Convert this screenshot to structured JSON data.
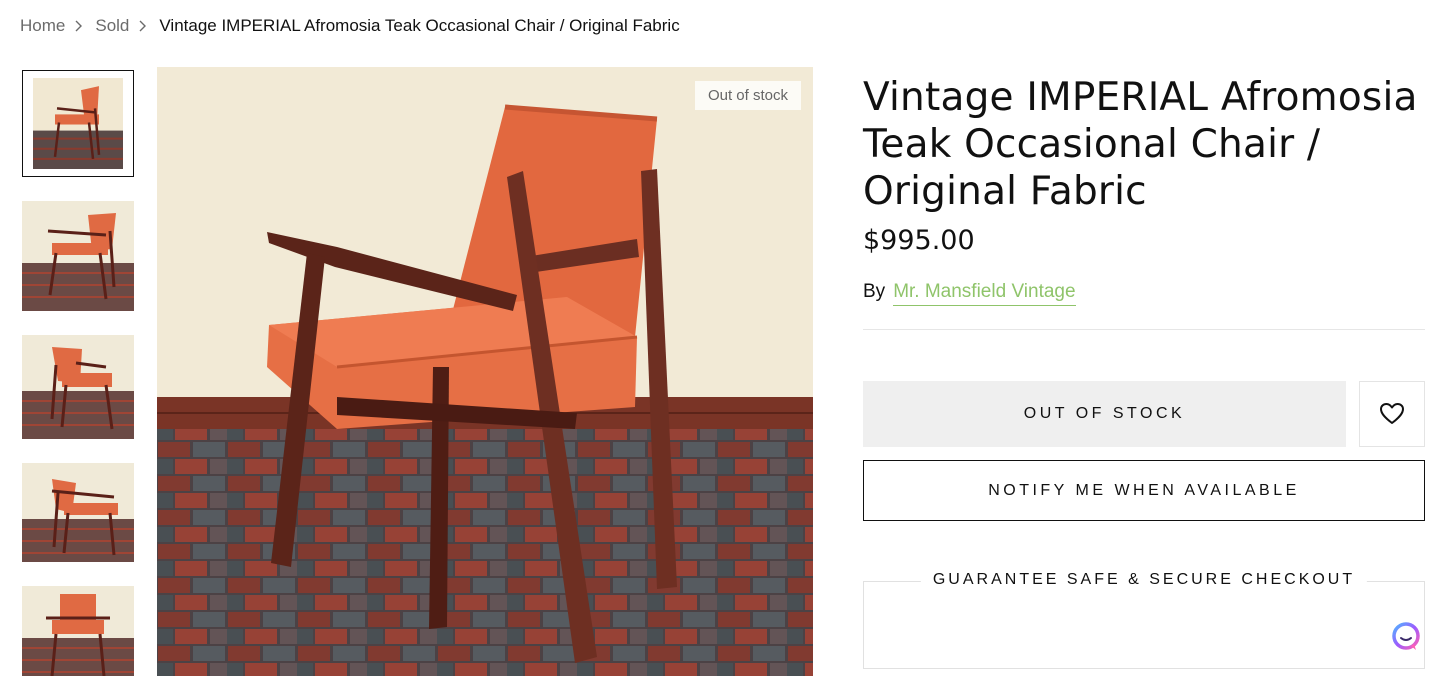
{
  "breadcrumb": {
    "home": "Home",
    "sold": "Sold",
    "current": "Vintage IMPERIAL Afromosia Teak Occasional Chair / Original Fabric"
  },
  "gallery": {
    "badge": "Out of stock",
    "thumbnail_count": 5,
    "active_thumbnail": 1
  },
  "product": {
    "title": "Vintage IMPERIAL Afromosia Teak Occasional Chair / Original Fabric",
    "price": "$995.00",
    "by_label": "By",
    "vendor": "Mr. Mansfield Vintage"
  },
  "actions": {
    "out_of_stock": "OUT OF STOCK",
    "notify": "NOTIFY ME WHEN AVAILABLE",
    "wishlist_icon": "heart-icon"
  },
  "guarantee": {
    "label": "GUARANTEE SAFE & SECURE CHECKOUT"
  },
  "colors": {
    "vendor_link": "#8fc46a",
    "button_gray": "#efefef",
    "upholstery": "#e2683f",
    "teak": "#6b2e22"
  }
}
